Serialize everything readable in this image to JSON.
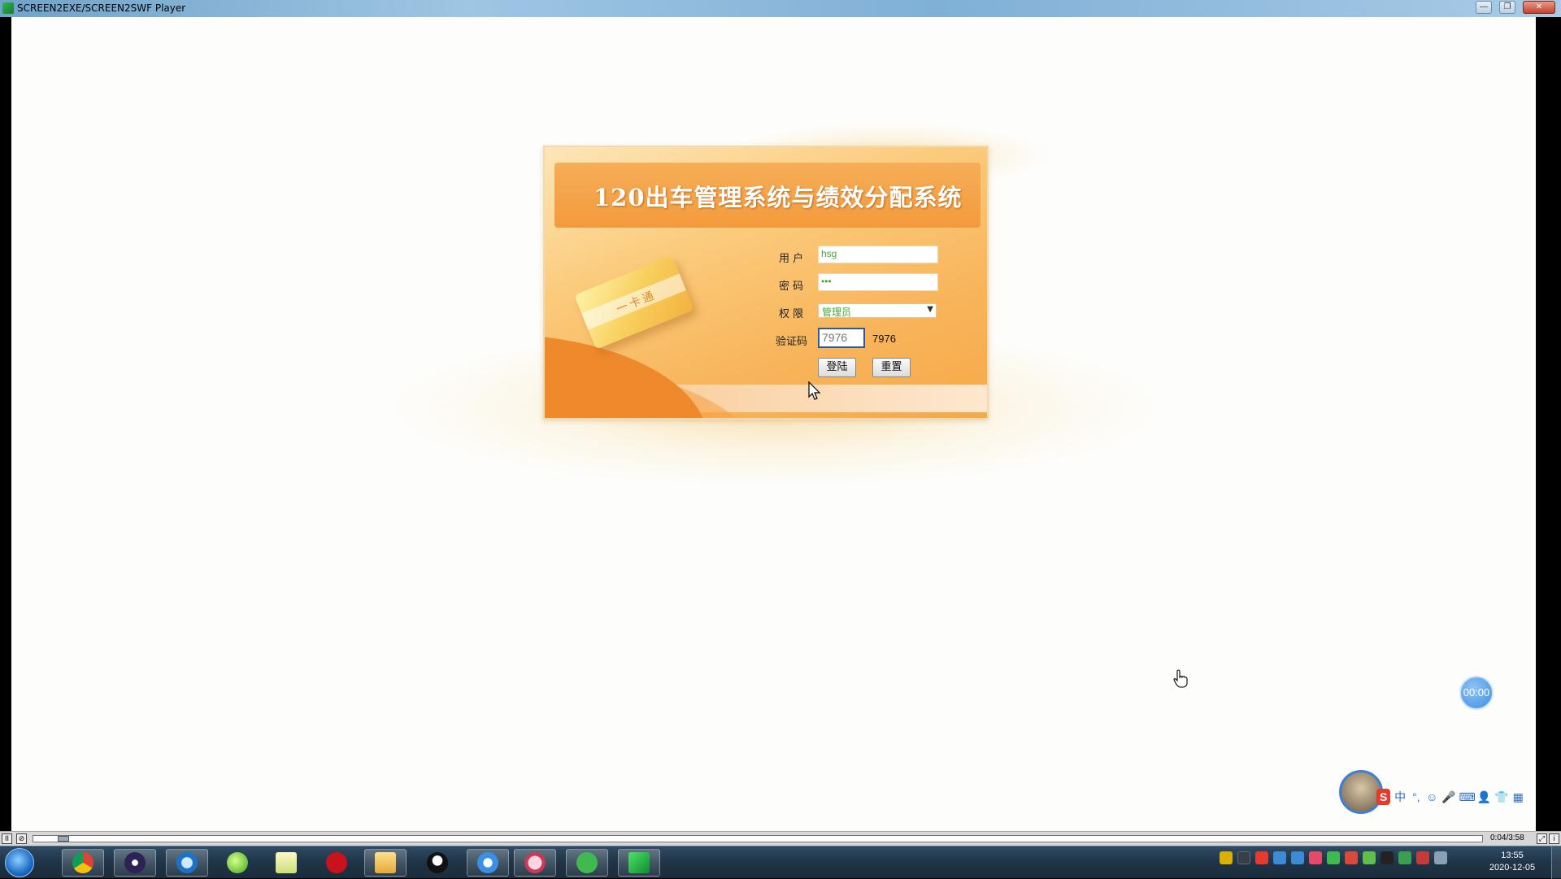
{
  "window": {
    "title": "SCREEN2EXE/SCREEN2SWF Player",
    "minimize": "—",
    "maximize": "❐",
    "close": "✕"
  },
  "login": {
    "system_title": "120出车管理系统与绩效分配系统",
    "card_text": "一卡通",
    "user_label": "用 户",
    "user_value": "hsg",
    "password_label": "密 码",
    "password_value": "•••",
    "role_label": "权 限",
    "role_selected": "管理员",
    "captcha_label": "验证码",
    "captcha_input": "7976",
    "captcha_code": "7976",
    "login_button": "登陆",
    "reset_button": "重置"
  },
  "overlay": {
    "timer": "00:00",
    "ime_items": [
      "中",
      "°,",
      "☺",
      "🎤",
      "⌨",
      "👤",
      "👕",
      "▦"
    ]
  },
  "player": {
    "pause": "II",
    "loop": "⊘",
    "time": "0:04/3:58",
    "progress": 0.017
  },
  "taskbar": {
    "time": "13:55",
    "date": "2020-12-05",
    "apps": [
      "chrome",
      "eclipse",
      "browser",
      "360",
      "notepad",
      "flash",
      "explorer",
      "qq",
      "baidu-netdisk",
      "avatar-app",
      "wechat",
      "screen-recorder"
    ]
  }
}
